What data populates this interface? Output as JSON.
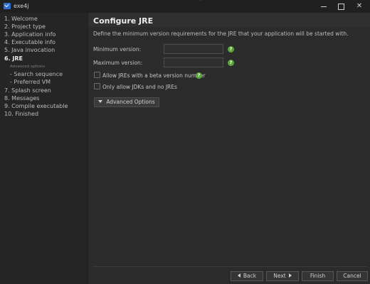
{
  "window": {
    "app_title": "exe4j",
    "background_title": "exe4j"
  },
  "sidebar": {
    "steps": [
      {
        "label": "1. Welcome"
      },
      {
        "label": "2. Project type"
      },
      {
        "label": "3. Application info"
      },
      {
        "label": "4. Executable info"
      },
      {
        "label": "5. Java invocation"
      },
      {
        "label": "6. JRE",
        "active": true
      },
      {
        "label": "7. Splash screen"
      },
      {
        "label": "8. Messages"
      },
      {
        "label": "9. Compile executable"
      },
      {
        "label": "10. Finished"
      }
    ],
    "advanced_heading": "Advanced options",
    "substeps": [
      {
        "label": "-  Search sequence"
      },
      {
        "label": "-  Preferred VM"
      }
    ]
  },
  "main": {
    "title": "Configure JRE",
    "description": "Define the minimum version requirements for the JRE that your application will be started with.",
    "min_version_label": "Minimum version:",
    "min_version_value": "",
    "max_version_label": "Maximum version:",
    "max_version_value": "",
    "help_glyph": "?",
    "beta_checkbox_label": "Allow JREs with a beta version number",
    "beta_checked": false,
    "jdk_checkbox_label": "Only allow JDKs and no JREs",
    "jdk_checked": false,
    "advanced_button_label": "Advanced Options"
  },
  "footer": {
    "back_label": "Back",
    "next_label": "Next",
    "finish_label": "Finish",
    "cancel_label": "Cancel"
  },
  "colors": {
    "background": "#202020",
    "content": "#2b2b2b",
    "help_icon": "#5aa638",
    "accent_icon": "#2f6fce"
  }
}
